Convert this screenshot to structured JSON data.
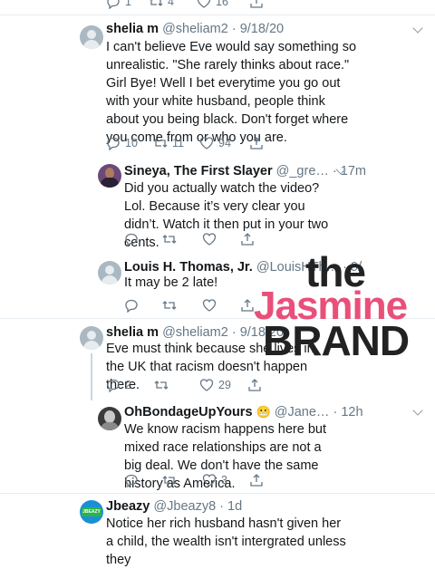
{
  "top_actions": {
    "reply_count": "1",
    "retweet_count": "4",
    "like_count": "16"
  },
  "tweets": [
    {
      "name": "shelia m",
      "handle": "@sheliam2 · 9/18/20",
      "text": "I can't believe Eve would say something so unrealistic. \"She rarely thinks about race.\" Girl Bye! Well I bet everytime you go out with your white husband, people think about you being black. Don't forget where you come from or who you are.",
      "replies": "10",
      "retweets": "11",
      "likes": "94"
    },
    {
      "name": "Sineya, The First Slayer",
      "handle": "@_gre… · 17m",
      "text": "Did you actually watch the video? Lol. Because it’s very clear you didn’t. Watch it then put in your two cents.",
      "replies": "",
      "retweets": "",
      "likes": ""
    },
    {
      "name": "Louis H. Thomas, Jr.",
      "handle": "@LouisHTh… · 9/",
      "text": "It may be 2 late!",
      "replies": "",
      "retweets": "",
      "likes": ""
    },
    {
      "name": "shelia m",
      "handle": "@sheliam2 · 9/18/20",
      "text": "Eve must think because she lives in the UK that racism doesn't happen there.",
      "replies": "2",
      "retweets": "",
      "likes": "29"
    },
    {
      "name": "OhBondageUpYours",
      "handle": "@Jane… · 12h",
      "text": "We know racism happens here but mixed race relationships are not a big deal. We don't have the same history as America.",
      "replies": "",
      "retweets": "",
      "likes": "3"
    },
    {
      "name": "Jbeazy",
      "handle": "@Jbeazy8 · 1d",
      "text": "Notice her rich husband hasn't given her a child, the wealth isn't intergrated unless they",
      "replies": "",
      "retweets": "",
      "likes": ""
    }
  ],
  "emoji": "😬",
  "jbeazy_avatar_text": "JBEAZY",
  "watermark": {
    "line1": "the",
    "line2": "Jasmine",
    "line3": "BRAND"
  },
  "colors": {
    "watermark_pink": "#e8507a",
    "watermark_dark": "#222222",
    "meta_gray": "#657786"
  }
}
